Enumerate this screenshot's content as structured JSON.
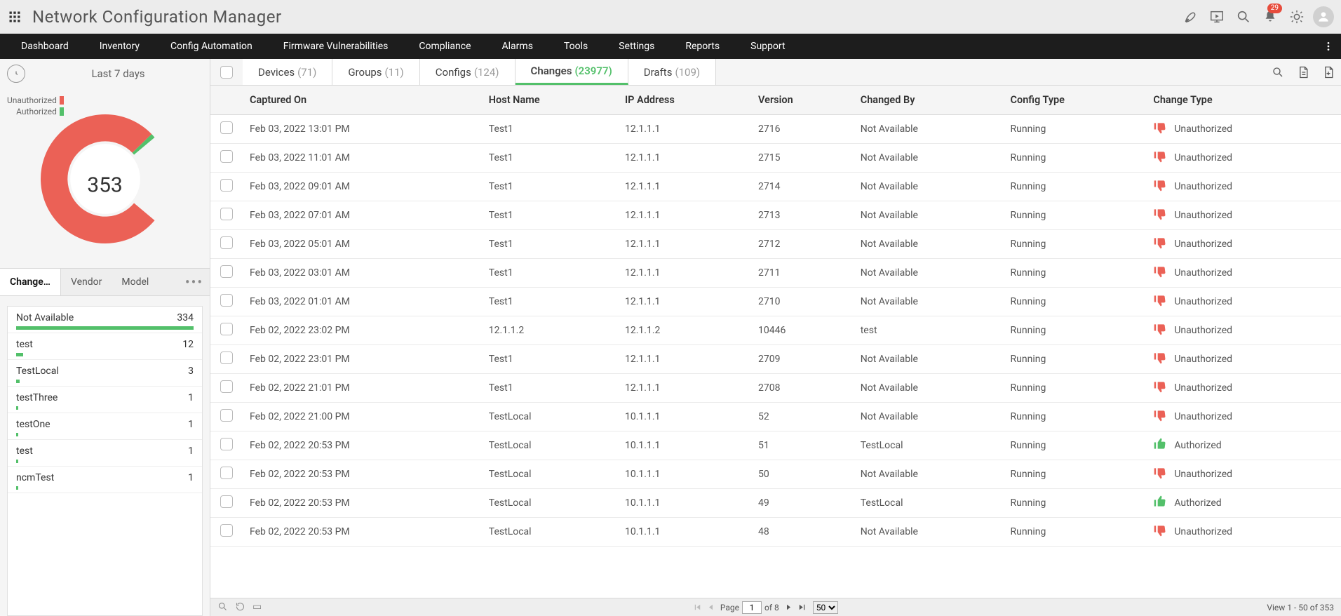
{
  "header": {
    "app_title": "Network Configuration Manager",
    "notifications_count": "29"
  },
  "nav": {
    "items": [
      "Dashboard",
      "Inventory",
      "Config Automation",
      "Firmware Vulnerabilities",
      "Compliance",
      "Alarms",
      "Tools",
      "Settings",
      "Reports",
      "Support"
    ]
  },
  "sidebar": {
    "range_label": "Last 7 days",
    "total": "353",
    "legend": {
      "unauthorized": "Unauthorized",
      "authorized": "Authorized"
    },
    "tabs": {
      "active": "Change…",
      "vendor": "Vendor",
      "model": "Model"
    },
    "list": [
      {
        "label": "Not Available",
        "count": "334",
        "pct": 100
      },
      {
        "label": "test",
        "count": "12",
        "pct": 4
      },
      {
        "label": "TestLocal",
        "count": "3",
        "pct": 2
      },
      {
        "label": "testThree",
        "count": "1",
        "pct": 1
      },
      {
        "label": "testOne",
        "count": "1",
        "pct": 1
      },
      {
        "label": "test",
        "count": "1",
        "pct": 1
      },
      {
        "label": "ncmTest",
        "count": "1",
        "pct": 1
      }
    ]
  },
  "main_tabs": [
    {
      "label": "Devices",
      "count": "(71)"
    },
    {
      "label": "Groups",
      "count": "(11)"
    },
    {
      "label": "Configs",
      "count": "(124)"
    },
    {
      "label": "Changes",
      "count": "(23977)",
      "active": true
    },
    {
      "label": "Drafts",
      "count": "(109)"
    }
  ],
  "table": {
    "columns": [
      "Captured On",
      "Host Name",
      "IP Address",
      "Version",
      "Changed By",
      "Config Type",
      "Change Type"
    ],
    "rows": [
      {
        "captured": "Feb 03, 2022 13:01 PM",
        "host": "Test1",
        "ip": "12.1.1.1",
        "ver": "2716",
        "by": "Not Available",
        "ctype": "Running",
        "change": "Unauthorized",
        "auth": false
      },
      {
        "captured": "Feb 03, 2022 11:01 AM",
        "host": "Test1",
        "ip": "12.1.1.1",
        "ver": "2715",
        "by": "Not Available",
        "ctype": "Running",
        "change": "Unauthorized",
        "auth": false
      },
      {
        "captured": "Feb 03, 2022 09:01 AM",
        "host": "Test1",
        "ip": "12.1.1.1",
        "ver": "2714",
        "by": "Not Available",
        "ctype": "Running",
        "change": "Unauthorized",
        "auth": false
      },
      {
        "captured": "Feb 03, 2022 07:01 AM",
        "host": "Test1",
        "ip": "12.1.1.1",
        "ver": "2713",
        "by": "Not Available",
        "ctype": "Running",
        "change": "Unauthorized",
        "auth": false
      },
      {
        "captured": "Feb 03, 2022 05:01 AM",
        "host": "Test1",
        "ip": "12.1.1.1",
        "ver": "2712",
        "by": "Not Available",
        "ctype": "Running",
        "change": "Unauthorized",
        "auth": false
      },
      {
        "captured": "Feb 03, 2022 03:01 AM",
        "host": "Test1",
        "ip": "12.1.1.1",
        "ver": "2711",
        "by": "Not Available",
        "ctype": "Running",
        "change": "Unauthorized",
        "auth": false
      },
      {
        "captured": "Feb 03, 2022 01:01 AM",
        "host": "Test1",
        "ip": "12.1.1.1",
        "ver": "2710",
        "by": "Not Available",
        "ctype": "Running",
        "change": "Unauthorized",
        "auth": false
      },
      {
        "captured": "Feb 02, 2022 23:02 PM",
        "host": "12.1.1.2",
        "ip": "12.1.1.2",
        "ver": "10446",
        "by": "test",
        "ctype": "Running",
        "change": "Unauthorized",
        "auth": false
      },
      {
        "captured": "Feb 02, 2022 23:01 PM",
        "host": "Test1",
        "ip": "12.1.1.1",
        "ver": "2709",
        "by": "Not Available",
        "ctype": "Running",
        "change": "Unauthorized",
        "auth": false
      },
      {
        "captured": "Feb 02, 2022 21:01 PM",
        "host": "Test1",
        "ip": "12.1.1.1",
        "ver": "2708",
        "by": "Not Available",
        "ctype": "Running",
        "change": "Unauthorized",
        "auth": false
      },
      {
        "captured": "Feb 02, 2022 21:00 PM",
        "host": "TestLocal",
        "ip": "10.1.1.1",
        "ver": "52",
        "by": "Not Available",
        "ctype": "Running",
        "change": "Unauthorized",
        "auth": false
      },
      {
        "captured": "Feb 02, 2022 20:53 PM",
        "host": "TestLocal",
        "ip": "10.1.1.1",
        "ver": "51",
        "by": "TestLocal",
        "ctype": "Running",
        "change": "Authorized",
        "auth": true
      },
      {
        "captured": "Feb 02, 2022 20:53 PM",
        "host": "TestLocal",
        "ip": "10.1.1.1",
        "ver": "50",
        "by": "Not Available",
        "ctype": "Running",
        "change": "Unauthorized",
        "auth": false
      },
      {
        "captured": "Feb 02, 2022 20:53 PM",
        "host": "TestLocal",
        "ip": "10.1.1.1",
        "ver": "49",
        "by": "TestLocal",
        "ctype": "Running",
        "change": "Authorized",
        "auth": true
      },
      {
        "captured": "Feb 02, 2022 20:53 PM",
        "host": "TestLocal",
        "ip": "10.1.1.1",
        "ver": "48",
        "by": "Not Available",
        "ctype": "Running",
        "change": "Unauthorized",
        "auth": false
      }
    ]
  },
  "pager": {
    "page_label": "Page",
    "page_value": "1",
    "of_label": "of 8",
    "page_size": "50",
    "view_text": "View 1 - 50 of 353"
  },
  "colors": {
    "unauthorized": "#eb6156",
    "authorized": "#53c06a"
  },
  "chart_data": {
    "type": "pie",
    "title": "",
    "total": 353,
    "categories": [
      "Unauthorized",
      "Authorized"
    ],
    "series": [
      {
        "name": "Changes",
        "values": [
          348,
          5
        ]
      }
    ],
    "colors": [
      "#eb6156",
      "#53c06a"
    ],
    "gap_deg": 80
  }
}
